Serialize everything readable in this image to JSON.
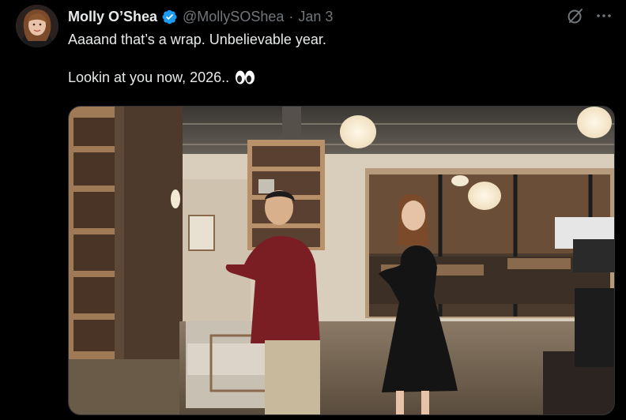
{
  "author": {
    "display_name": "Molly O’Shea",
    "handle": "@MollySOShea",
    "separator": "·",
    "date": "Jan 3",
    "verified": true
  },
  "tweet": {
    "line1": "Aaaand that’s a wrap. Unbelievable year.",
    "line2": "Lookin at you now, 2026..",
    "emoji": "eyes-emoji"
  },
  "icons": {
    "grok": "grok-icon",
    "more": "more-icon",
    "verified": "verified-badge-icon"
  },
  "colors": {
    "background": "#000000",
    "text": "#e7e9ea",
    "muted": "#71767b",
    "verified_blue": "#1d9bf0"
  }
}
